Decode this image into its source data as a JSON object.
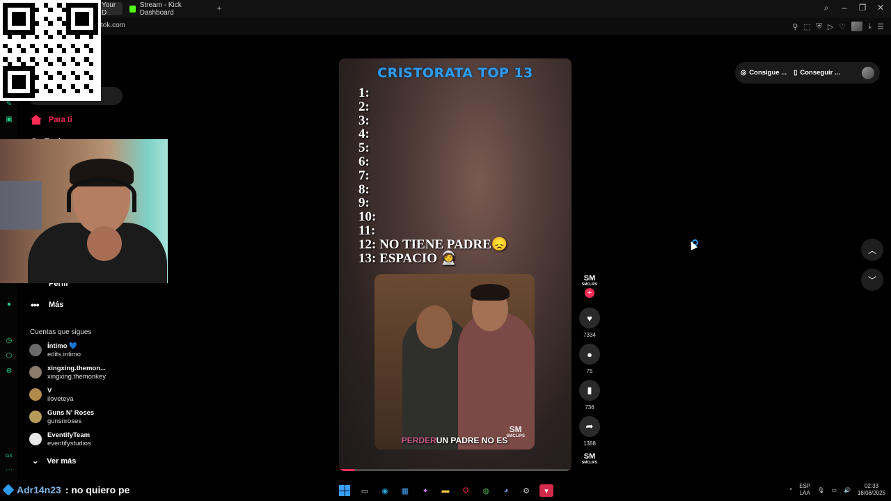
{
  "browser": {
    "tabs": [
      {
        "label": "Your D"
      },
      {
        "label": "Stream - Kick Dashboard"
      }
    ],
    "url": "tok.com"
  },
  "sidebar": {
    "for_you": "Para ti",
    "explore": "Explorar",
    "profile": "Perfil",
    "more": "Más",
    "following_title": "Cuentas que sigues",
    "following": [
      {
        "name": "Íntimo 💙",
        "handle": "edits.intimo",
        "color": "#6a6a6a"
      },
      {
        "name": "xingxing.themon...",
        "handle": "xingxing.themonkey",
        "color": "#8c7a6b"
      },
      {
        "name": "V",
        "handle": "iloveteya",
        "color": "#b08a4a"
      },
      {
        "name": "Guns N' Roses",
        "handle": "gunsnroses",
        "color": "#b59a5a"
      },
      {
        "name": "EventifyTeam",
        "handle": "eventifystudios",
        "color": "#e8e8e8"
      }
    ],
    "see_more": "Ver más"
  },
  "video": {
    "title": "CRISTORATA TOP 13",
    "ranks": [
      "1:",
      "2:",
      "3:",
      "4:",
      "5:",
      "6:",
      "7:",
      "8:",
      "9:",
      "10:",
      "11:",
      "12: NO TIENE PADRE😞",
      "13: ESPACIO 🧑‍🚀"
    ],
    "subtitle_highlight": "PERDER",
    "subtitle_rest": "UN PADRE NO ES",
    "watermark_logo": "SM",
    "watermark_text": "SMCLIPS",
    "progress": 0.07
  },
  "actions": {
    "creator_logo": "SM",
    "creator_text": "SMCLIPS",
    "likes": "7334",
    "comments": "75",
    "saves": "736",
    "shares": "1388"
  },
  "top_right": {
    "coins": "Consigue ...",
    "app": "Conseguir ..."
  },
  "chat": {
    "user": "Adr14n23",
    "message": ": no quiero pe"
  },
  "tray": {
    "lang_top": "ESP",
    "lang_bottom": "LAA",
    "time": "02:33",
    "date": "18/08/2025"
  }
}
